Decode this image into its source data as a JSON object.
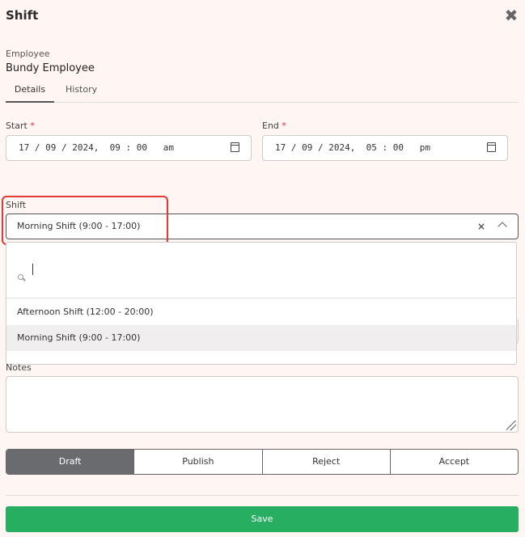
{
  "dialog": {
    "title": "Shift"
  },
  "employee": {
    "label": "Employee",
    "name": "Bundy Employee"
  },
  "tabs": [
    {
      "label": "Details",
      "active": true
    },
    {
      "label": "History",
      "active": false
    }
  ],
  "start": {
    "label": "Start",
    "required_mark": "*",
    "value": "17 / 09 / 2024,  09 : 00   am"
  },
  "end": {
    "label": "End",
    "required_mark": "*",
    "value": "17 / 09 / 2024,  05 : 00   pm"
  },
  "shift": {
    "label": "Shift",
    "value": "Morning Shift (9:00 - 17:00)",
    "clear_symbol": "×",
    "options": [
      {
        "label": "Afternoon Shift (12:00 - 20:00)",
        "selected": false
      },
      {
        "label": "Morning Shift (9:00 - 17:00)",
        "selected": true
      }
    ]
  },
  "notes": {
    "label": "Notes",
    "value": ""
  },
  "status_buttons": [
    {
      "label": "Draft",
      "active": true
    },
    {
      "label": "Publish",
      "active": false
    },
    {
      "label": "Reject",
      "active": false
    },
    {
      "label": "Accept",
      "active": false
    }
  ],
  "save": {
    "label": "Save"
  },
  "colors": {
    "save_green": "#27ae60",
    "active_status": "#6a6b6f",
    "highlight_red": "#e53935",
    "required_red": "#dd3333"
  },
  "icons": {
    "close": "close-icon",
    "calendar": "calendar-icon",
    "search": "search-icon",
    "chevron": "chevron-up-icon",
    "clear": "clear-icon"
  }
}
